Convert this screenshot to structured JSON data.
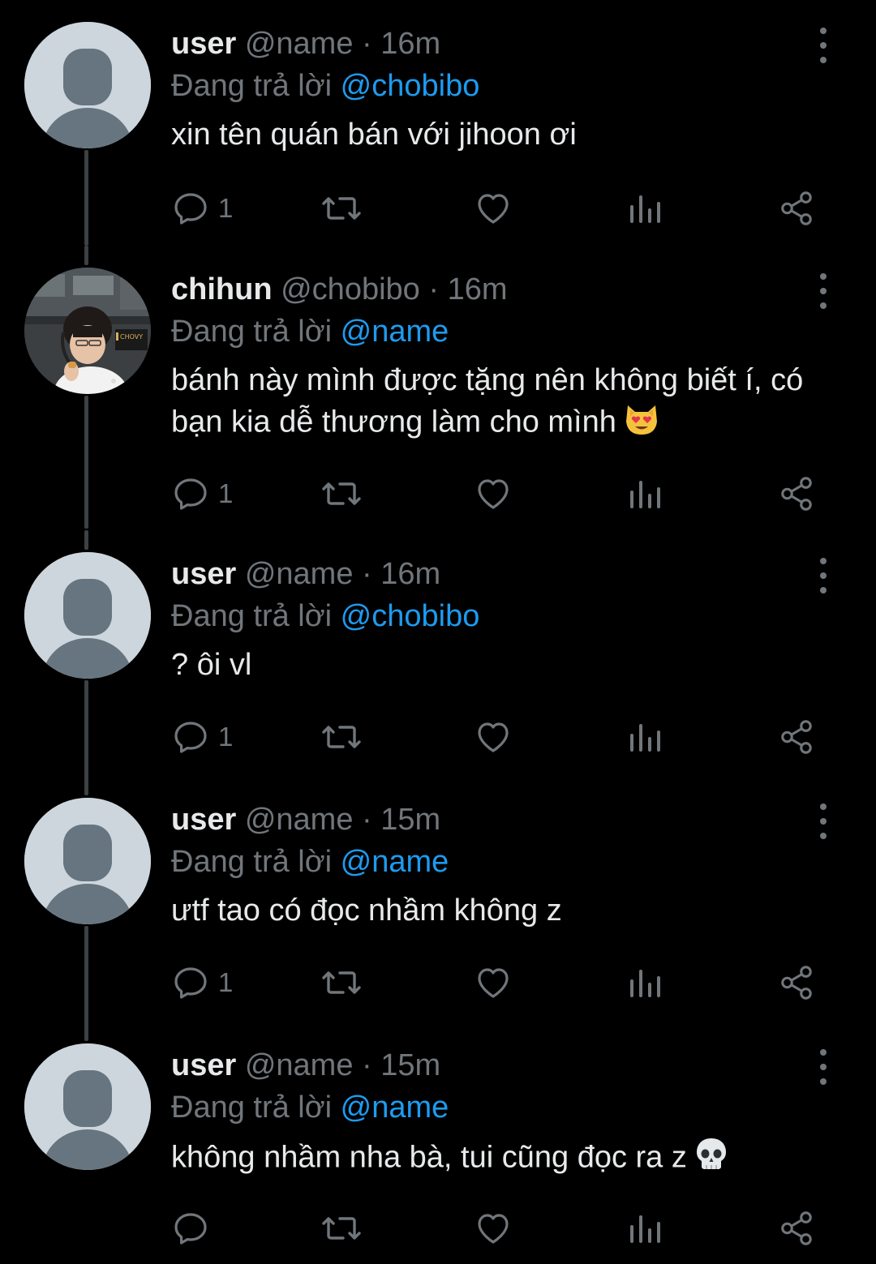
{
  "colors": {
    "background": "#000000",
    "text": "#e7e9ea",
    "muted": "#71767b",
    "link": "#1d9bf0",
    "thread_line": "#3c4146",
    "placeholder_avatar": "#cdd6dd"
  },
  "reply_prefix": "Đang trả lời",
  "tweets": [
    {
      "display_name": "user",
      "handle": "@name",
      "separator": "·",
      "time": "16m",
      "reply_to": "@chobibo",
      "text": "xin tên quán bán với jihoon ơi",
      "reply_count": "1",
      "avatar_icon": "default-profile-icon"
    },
    {
      "display_name": "chihun",
      "handle": "@chobibo",
      "separator": "·",
      "time": "16m",
      "reply_to": "@name",
      "text": "bánh này mình được tặng nên không biết í, có bạn kia dễ thương làm cho mình",
      "emoji_icon": "heart-eyes-cat-emoji",
      "reply_count": "1",
      "avatar_icon": "photo-avatar",
      "avatar_badge": "CHOVY"
    },
    {
      "display_name": "user",
      "handle": "@name",
      "separator": "·",
      "time": "16m",
      "reply_to": "@chobibo",
      "text": "? ôi vl",
      "reply_count": "1",
      "avatar_icon": "default-profile-icon"
    },
    {
      "display_name": "user",
      "handle": "@name",
      "separator": "·",
      "time": "15m",
      "reply_to": "@name",
      "text": "ưtf tao có đọc nhầm không z",
      "reply_count": "1",
      "avatar_icon": "default-profile-icon"
    },
    {
      "display_name": "user",
      "handle": "@name",
      "separator": "·",
      "time": "15m",
      "reply_to": "@name",
      "text": "không nhầm nha bà, tui cũng đọc ra z",
      "emoji_icon": "skull-emoji",
      "reply_count": "",
      "avatar_icon": "default-profile-icon"
    }
  ]
}
